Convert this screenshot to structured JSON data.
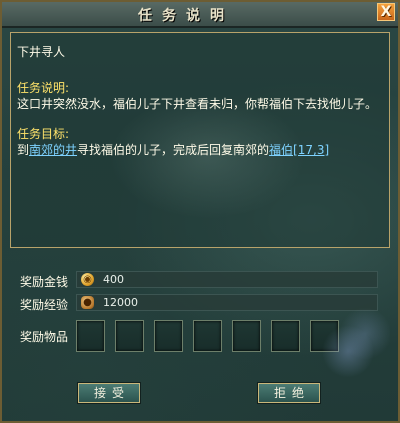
{
  "window": {
    "title": "任务说明",
    "close_label": "X"
  },
  "quest": {
    "name": "下井寻人",
    "desc_label": "任务说明:",
    "desc_text": "这口井突然没水，福伯儿子下井查看未归，你帮福伯下去找他儿子。",
    "goal_label": "任务目标:",
    "goal_prefix": "到",
    "goal_link_place": "南郊的井",
    "goal_middle": "寻找福伯的儿子，完成后回复南郊的",
    "goal_link_npc": "福伯[17,3]"
  },
  "rewards": {
    "money_label": "奖励金钱",
    "money_value": "400",
    "exp_label": "奖励经验",
    "exp_value": "12000",
    "items_label": "奖励物品",
    "item_slots": [
      null,
      null,
      null,
      null,
      null,
      null,
      null
    ]
  },
  "buttons": {
    "accept": "接受",
    "reject": "拒绝"
  },
  "icons": {
    "money": "coin-icon",
    "exp": "exp-pouch-icon"
  }
}
